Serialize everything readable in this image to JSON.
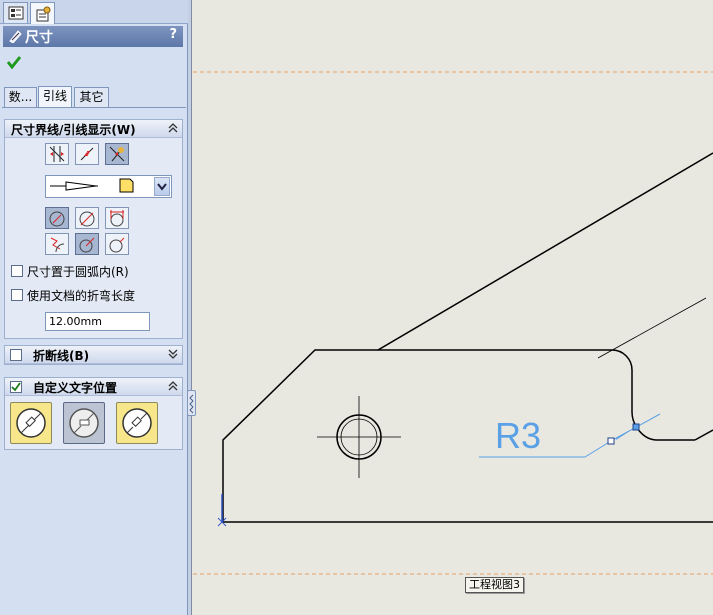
{
  "property_manager": {
    "top_tabs": [
      {
        "name": "feature-manager-tab",
        "icon": "feature-tree-icon",
        "active": false
      },
      {
        "name": "property-manager-tab",
        "icon": "property-manager-icon",
        "active": true
      }
    ],
    "title": "尺寸",
    "title_icon": "dimension-icon",
    "help_label": "?",
    "ok_icon": "green-check-icon",
    "tabs": [
      {
        "label": "数...",
        "active": false
      },
      {
        "label": "引线",
        "active": true
      },
      {
        "label": "其它",
        "active": false
      }
    ]
  },
  "witness_group": {
    "title": "尺寸界线/引线显示(W)",
    "arrow_buttons": [
      "arrows-outside-icon",
      "arrows-inside-icon",
      "smart-arrows-icon"
    ],
    "arrow_style_select": {
      "selected": "open-arrow-icon"
    },
    "radius_buttons": [
      "radial-leader-icon",
      "diameter-leader-icon",
      "linear-leader-icon",
      "foreshortened-icon",
      "solid-leader-icon",
      "open-leader-icon"
    ],
    "inside_arc_label": "尺寸置于圆弧内(R)",
    "inside_arc_checked": false,
    "doc_bend_label": "使用文档的折弯长度",
    "doc_bend_checked": false,
    "bend_length_value": "12.00mm"
  },
  "break_group": {
    "title": "折断线(B)",
    "checked": false
  },
  "text_position_group": {
    "title": "自定义文字位置",
    "checked": true,
    "buttons": [
      "solid-leader-aligned-text-icon",
      "broken-leader-horizontal-text-icon",
      "broken-leader-aligned-text-icon"
    ],
    "pressed_index": 1
  },
  "drawing": {
    "dimension_text": "R3",
    "view_label": "工程视图3",
    "colors": {
      "background": "#e8e7e0",
      "geometry": "#000000",
      "dimension": "#5aa0e6",
      "sheet_border": "#e8a060"
    }
  }
}
